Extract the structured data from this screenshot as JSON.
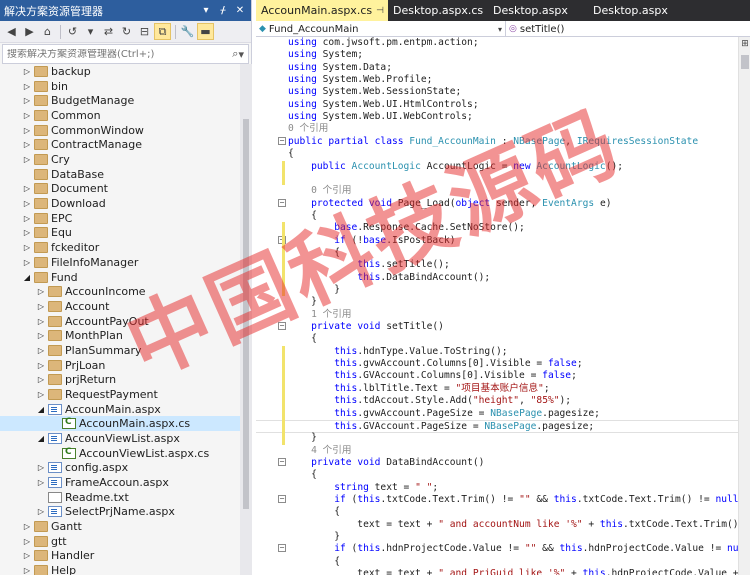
{
  "solution_explorer": {
    "title": "解决方案资源管理器",
    "search_placeholder": "搜索解决方案资源管理器(Ctrl+;)",
    "tree": [
      {
        "label": "backup",
        "type": "folder",
        "depth": 0,
        "expander": "collapsed"
      },
      {
        "label": "bin",
        "type": "folder",
        "depth": 0,
        "expander": "collapsed"
      },
      {
        "label": "BudgetManage",
        "type": "folder",
        "depth": 0,
        "expander": "collapsed"
      },
      {
        "label": "Common",
        "type": "folder",
        "depth": 0,
        "expander": "collapsed"
      },
      {
        "label": "CommonWindow",
        "type": "folder",
        "depth": 0,
        "expander": "collapsed"
      },
      {
        "label": "ContractManage",
        "type": "folder",
        "depth": 0,
        "expander": "collapsed"
      },
      {
        "label": "Cry",
        "type": "folder",
        "depth": 0,
        "expander": "collapsed"
      },
      {
        "label": "DataBase",
        "type": "folder",
        "depth": 0,
        "expander": "none"
      },
      {
        "label": "Document",
        "type": "folder",
        "depth": 0,
        "expander": "collapsed"
      },
      {
        "label": "Download",
        "type": "folder",
        "depth": 0,
        "expander": "collapsed"
      },
      {
        "label": "EPC",
        "type": "folder",
        "depth": 0,
        "expander": "collapsed"
      },
      {
        "label": "Equ",
        "type": "folder",
        "depth": 0,
        "expander": "collapsed"
      },
      {
        "label": "fckeditor",
        "type": "folder",
        "depth": 0,
        "expander": "collapsed"
      },
      {
        "label": "FileInfoManager",
        "type": "folder",
        "depth": 0,
        "expander": "collapsed"
      },
      {
        "label": "Fund",
        "type": "folder",
        "depth": 0,
        "expander": "expanded"
      },
      {
        "label": "AccounIncome",
        "type": "folder",
        "depth": 1,
        "expander": "collapsed"
      },
      {
        "label": "Account",
        "type": "folder",
        "depth": 1,
        "expander": "collapsed"
      },
      {
        "label": "AccountPayOut",
        "type": "folder",
        "depth": 1,
        "expander": "collapsed"
      },
      {
        "label": "MonthPlan",
        "type": "folder",
        "depth": 1,
        "expander": "collapsed"
      },
      {
        "label": "PlanSummary",
        "type": "folder",
        "depth": 1,
        "expander": "collapsed"
      },
      {
        "label": "PrjLoan",
        "type": "folder",
        "depth": 1,
        "expander": "collapsed"
      },
      {
        "label": "prjReturn",
        "type": "folder",
        "depth": 1,
        "expander": "collapsed"
      },
      {
        "label": "RequestPayment",
        "type": "folder",
        "depth": 1,
        "expander": "collapsed"
      },
      {
        "label": "AccounMain.aspx",
        "type": "page",
        "depth": 1,
        "expander": "expanded"
      },
      {
        "label": "AccounMain.aspx.cs",
        "type": "cs",
        "depth": 2,
        "expander": "none",
        "selected": true
      },
      {
        "label": "AccounViewList.aspx",
        "type": "page",
        "depth": 1,
        "expander": "expanded"
      },
      {
        "label": "AccounViewList.aspx.cs",
        "type": "cs",
        "depth": 2,
        "expander": "none"
      },
      {
        "label": "config.aspx",
        "type": "page",
        "depth": 1,
        "expander": "collapsed"
      },
      {
        "label": "FrameAccoun.aspx",
        "type": "page",
        "depth": 1,
        "expander": "collapsed"
      },
      {
        "label": "Readme.txt",
        "type": "txt",
        "depth": 1,
        "expander": "none"
      },
      {
        "label": "SelectPrjName.aspx",
        "type": "page",
        "depth": 1,
        "expander": "collapsed"
      },
      {
        "label": "Gantt",
        "type": "folder",
        "depth": 0,
        "expander": "collapsed"
      },
      {
        "label": "gtt",
        "type": "folder",
        "depth": 0,
        "expander": "collapsed"
      },
      {
        "label": "Handler",
        "type": "folder",
        "depth": 0,
        "expander": "collapsed"
      },
      {
        "label": "Help",
        "type": "folder",
        "depth": 0,
        "expander": "collapsed"
      }
    ]
  },
  "editor": {
    "tabs": [
      {
        "label": "AccounMain.aspx.cs",
        "active": true
      },
      {
        "label": "Desktop.aspx.cs",
        "active": false
      },
      {
        "label": "Desktop.aspx",
        "active": false
      },
      {
        "label": "Desktop.aspx",
        "active": false
      }
    ],
    "nav_class": "Fund_AccounMain",
    "nav_member": "setTitle()",
    "code_lines": [
      [
        [
          "kw",
          "using "
        ],
        [
          "pl",
          "com.jwsoft.pm.entpm.action;"
        ]
      ],
      [
        [
          "kw",
          "using "
        ],
        [
          "pl",
          "System;"
        ]
      ],
      [
        [
          "kw",
          "using "
        ],
        [
          "pl",
          "System.Data;"
        ]
      ],
      [
        [
          "kw",
          "using "
        ],
        [
          "pl",
          "System.Web.Profile;"
        ]
      ],
      [
        [
          "kw",
          "using "
        ],
        [
          "pl",
          "System.Web.SessionState;"
        ]
      ],
      [
        [
          "kw",
          "using "
        ],
        [
          "pl",
          "System.Web.UI.HtmlControls;"
        ]
      ],
      [
        [
          "kw",
          "using "
        ],
        [
          "pl",
          "System.Web.UI.WebControls;"
        ]
      ],
      [
        [
          "rf",
          "0 个引用"
        ]
      ],
      [
        [
          "kw",
          "public partial class "
        ],
        [
          "ty",
          "Fund_AccounMain"
        ],
        [
          "pl",
          " : "
        ],
        [
          "ty",
          "NBasePage"
        ],
        [
          "pl",
          ", "
        ],
        [
          "ty",
          "IRequiresSessionState"
        ]
      ],
      [
        [
          "pl",
          "{"
        ]
      ],
      [
        [
          "pl",
          "    "
        ],
        [
          "kw",
          "public "
        ],
        [
          "ty",
          "AccountLogic "
        ],
        [
          "pl",
          "AccountLogic = "
        ],
        [
          "kw",
          "new "
        ],
        [
          "ty",
          "AccountLogic"
        ],
        [
          "pl",
          "();"
        ]
      ],
      [
        [
          "pl",
          ""
        ]
      ],
      [
        [
          "rf",
          "    0 个引用"
        ]
      ],
      [
        [
          "pl",
          "    "
        ],
        [
          "kw",
          "protected void "
        ],
        [
          "pl",
          "Page_Load("
        ],
        [
          "kw",
          "object "
        ],
        [
          "pl",
          "sender, "
        ],
        [
          "ty",
          "EventArgs "
        ],
        [
          "pl",
          "e)"
        ]
      ],
      [
        [
          "pl",
          "    {"
        ]
      ],
      [
        [
          "pl",
          "        "
        ],
        [
          "kw",
          "base"
        ],
        [
          "pl",
          ".Response.Cache.SetNoStore();"
        ]
      ],
      [
        [
          "pl",
          "        "
        ],
        [
          "kw",
          "if "
        ],
        [
          "pl",
          "(!"
        ],
        [
          "kw",
          "base"
        ],
        [
          "pl",
          ".IsPostBack)"
        ]
      ],
      [
        [
          "pl",
          "        {"
        ]
      ],
      [
        [
          "pl",
          "            "
        ],
        [
          "kw",
          "this"
        ],
        [
          "pl",
          ".setTitle();"
        ]
      ],
      [
        [
          "pl",
          "            "
        ],
        [
          "kw",
          "this"
        ],
        [
          "pl",
          ".DataBindAccount();"
        ]
      ],
      [
        [
          "pl",
          "        }"
        ]
      ],
      [
        [
          "pl",
          "    }"
        ]
      ],
      [
        [
          "rf",
          "    1 个引用"
        ]
      ],
      [
        [
          "pl",
          "    "
        ],
        [
          "kw",
          "private void "
        ],
        [
          "pl",
          "setTitle()"
        ]
      ],
      [
        [
          "pl",
          "    {"
        ]
      ],
      [
        [
          "pl",
          "        "
        ],
        [
          "kw",
          "this"
        ],
        [
          "pl",
          ".hdnType.Value.ToString();"
        ]
      ],
      [
        [
          "pl",
          "        "
        ],
        [
          "kw",
          "this"
        ],
        [
          "pl",
          ".gvwAccount.Columns[0].Visible = "
        ],
        [
          "kw",
          "false"
        ],
        [
          "pl",
          ";"
        ]
      ],
      [
        [
          "pl",
          "        "
        ],
        [
          "kw",
          "this"
        ],
        [
          "pl",
          ".GVAccount.Columns[0].Visible = "
        ],
        [
          "kw",
          "false"
        ],
        [
          "pl",
          ";"
        ]
      ],
      [
        [
          "pl",
          "        "
        ],
        [
          "kw",
          "this"
        ],
        [
          "pl",
          ".lblTitle.Text = "
        ],
        [
          "st",
          "\"项目基本账户信息\""
        ],
        [
          "pl",
          ";"
        ]
      ],
      [
        [
          "pl",
          "        "
        ],
        [
          "kw",
          "this"
        ],
        [
          "pl",
          ".tdAccout.Style.Add("
        ],
        [
          "st",
          "\"height\""
        ],
        [
          "pl",
          ", "
        ],
        [
          "st",
          "\"85%\""
        ],
        [
          "pl",
          ");"
        ]
      ],
      [
        [
          "pl",
          "        "
        ],
        [
          "kw",
          "this"
        ],
        [
          "pl",
          ".gvwAccount.PageSize = "
        ],
        [
          "ty",
          "NBasePage"
        ],
        [
          "pl",
          ".pagesize;"
        ]
      ],
      [
        [
          "pl",
          "        "
        ],
        [
          "kw",
          "this"
        ],
        [
          "pl",
          ".GVAccount.PageSize = "
        ],
        [
          "ty",
          "NBasePage"
        ],
        [
          "pl",
          ".pagesize;"
        ]
      ],
      [
        [
          "pl",
          "    }"
        ]
      ],
      [
        [
          "rf",
          "    4 个引用"
        ]
      ],
      [
        [
          "pl",
          "    "
        ],
        [
          "kw",
          "private void "
        ],
        [
          "pl",
          "DataBindAccount()"
        ]
      ],
      [
        [
          "pl",
          "    {"
        ]
      ],
      [
        [
          "pl",
          "        "
        ],
        [
          "kw",
          "string "
        ],
        [
          "pl",
          "text = "
        ],
        [
          "st",
          "\" \""
        ],
        [
          "pl",
          ";"
        ]
      ],
      [
        [
          "pl",
          "        "
        ],
        [
          "kw",
          "if "
        ],
        [
          "pl",
          "("
        ],
        [
          "kw",
          "this"
        ],
        [
          "pl",
          ".txtCode.Text.Trim() != "
        ],
        [
          "st",
          "\"\""
        ],
        [
          "pl",
          " && "
        ],
        [
          "kw",
          "this"
        ],
        [
          "pl",
          ".txtCode.Text.Trim() != "
        ],
        [
          "kw",
          "null"
        ],
        [
          "pl",
          ")"
        ]
      ],
      [
        [
          "pl",
          "        {"
        ]
      ],
      [
        [
          "pl",
          "            text = text + "
        ],
        [
          "st",
          "\" and accountNum like '%\""
        ],
        [
          "pl",
          " + "
        ],
        [
          "kw",
          "this"
        ],
        [
          "pl",
          ".txtCode.Text.Trim().ToStr"
        ]
      ],
      [
        [
          "pl",
          "        }"
        ]
      ],
      [
        [
          "pl",
          "        "
        ],
        [
          "kw",
          "if "
        ],
        [
          "pl",
          "("
        ],
        [
          "kw",
          "this"
        ],
        [
          "pl",
          ".hdnProjectCode.Value != "
        ],
        [
          "st",
          "\"\""
        ],
        [
          "pl",
          " && "
        ],
        [
          "kw",
          "this"
        ],
        [
          "pl",
          ".hdnProjectCode.Value != "
        ],
        [
          "kw",
          "null"
        ],
        [
          "pl",
          ")"
        ]
      ],
      [
        [
          "pl",
          "        {"
        ]
      ],
      [
        [
          "pl",
          "            text = text + "
        ],
        [
          "st",
          "\" and PrjGuid like '%\""
        ],
        [
          "pl",
          " + "
        ],
        [
          "kw",
          "this"
        ],
        [
          "pl",
          ".hdnProjectCode.Value + "
        ],
        [
          "st",
          "\"%' \""
        ]
      ]
    ],
    "watermark": "中国科技源码"
  },
  "colors": {
    "keyword": "#0000ff",
    "type": "#2b91af",
    "string": "#a31515",
    "active_tab": "#fff29d",
    "tool_window_title": "#2d5e9e"
  }
}
